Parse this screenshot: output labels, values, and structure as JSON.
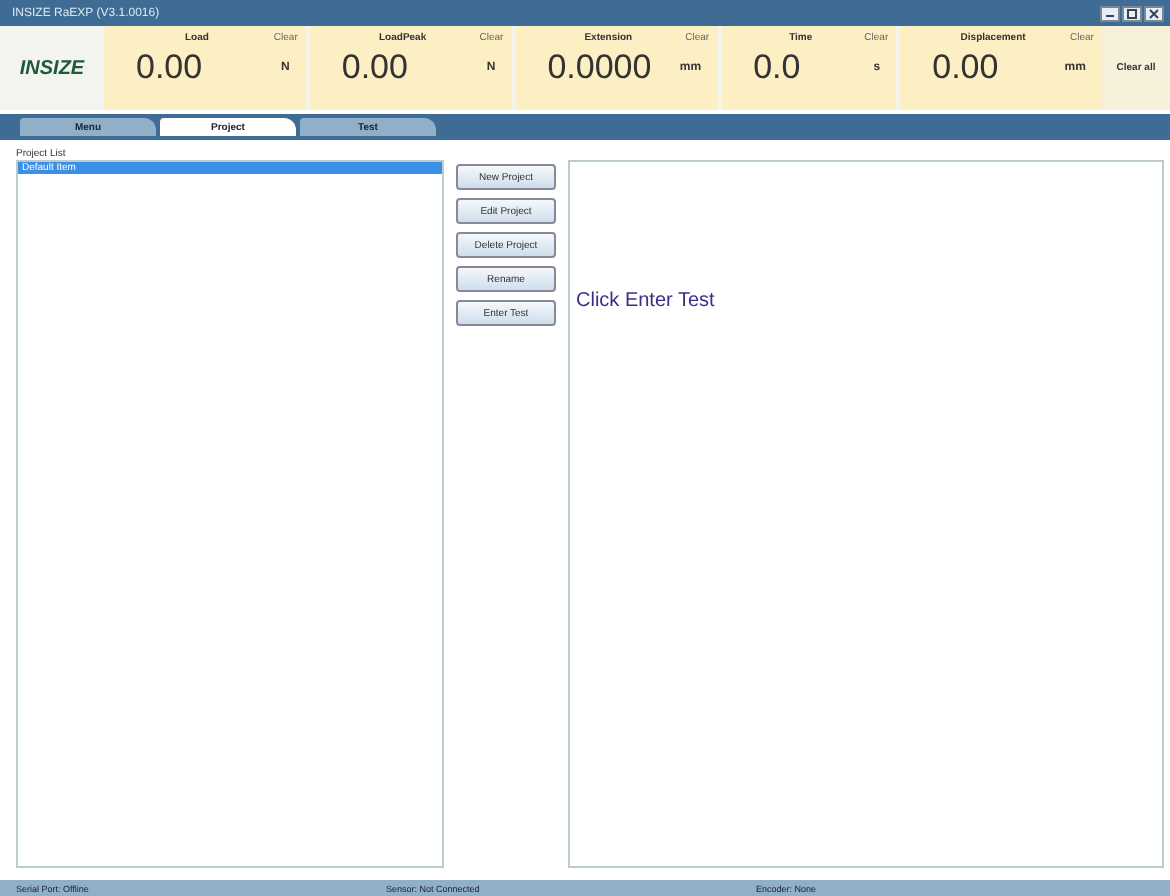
{
  "window": {
    "title": "INSIZE RaEXP (V3.1.0016)"
  },
  "logo": {
    "text": "INSIZE"
  },
  "readouts": [
    {
      "label": "Load",
      "value": "0.00",
      "unit": "N",
      "clear": "Clear"
    },
    {
      "label": "LoadPeak",
      "value": "0.00",
      "unit": "N",
      "clear": "Clear"
    },
    {
      "label": "Extension",
      "value": "0.0000",
      "unit": "mm",
      "clear": "Clear"
    },
    {
      "label": "Time",
      "value": "0.0",
      "unit": "s",
      "clear": "Clear"
    },
    {
      "label": "Displacement",
      "value": "0.00",
      "unit": "mm",
      "clear": "Clear"
    }
  ],
  "clear_all": "Clear all",
  "tabs": [
    {
      "label": "Menu",
      "selected": false
    },
    {
      "label": "Project",
      "selected": true
    },
    {
      "label": "Test",
      "selected": false
    }
  ],
  "project_list": {
    "label": "Project List",
    "items": [
      {
        "label": "Default Item",
        "selected": true
      }
    ]
  },
  "buttons": [
    "New Project",
    "Edit Project",
    "Delete Project",
    "Rename",
    "Enter Test"
  ],
  "message": "Click Enter Test",
  "status_bar": [
    "Serial Port: Offline",
    "Sensor: Not Connected",
    "Encoder: None"
  ]
}
